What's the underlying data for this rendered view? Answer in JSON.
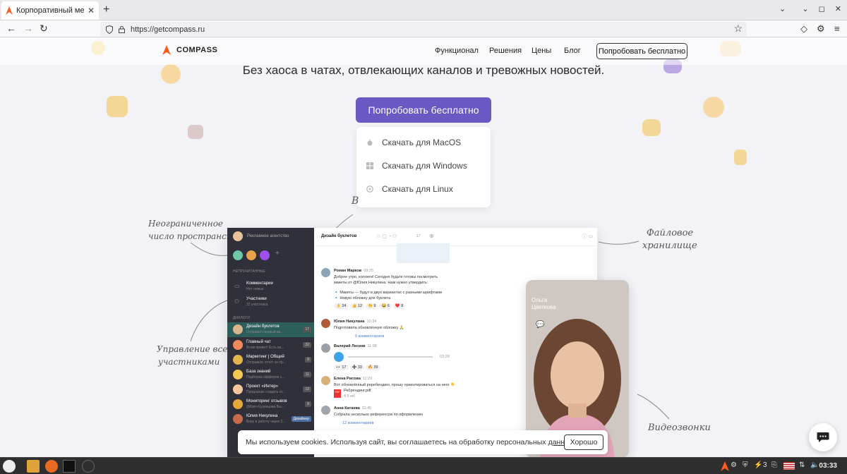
{
  "browser": {
    "tab_title": "Корпоративный мессендж",
    "url": "https://getcompass.ru"
  },
  "site": {
    "logo": "COMPASS",
    "nav": [
      "Функционал",
      "Решения",
      "Цены",
      "Блог"
    ],
    "try_top": "Попробовать бесплатно",
    "subheading": "Без хаоса в чатах, отвлекающих каналов и тревожных новостей.",
    "cta": "Попробовать бесплатно",
    "downloads": [
      "Скачать для MacOS",
      "Скачать для Windows",
      "Скачать для Linux"
    ],
    "annotation_partial": "В",
    "annotations": {
      "spaces_1": "Неограниченное",
      "spaces_2": "число пространств",
      "manage_1": "Управление всеми",
      "manage_2": "участниками",
      "files_1": "Файловое",
      "files_2": "хранилище",
      "video": "Видеозвонки"
    }
  },
  "app": {
    "workspace": "Рекламное агентство",
    "section_unread": "НЕПРОЧИТАННЫЕ",
    "section_dialogs": "ДИАЛОГИ",
    "pinned": [
      {
        "name": "Комментарии",
        "preview": "Нет новых"
      },
      {
        "name": "Участники",
        "preview": "32 участника"
      }
    ],
    "chats": [
      {
        "name": "Дизайн буклетов",
        "preview": "Отправил первый ва...",
        "badge": "17"
      },
      {
        "name": "Главный чат",
        "preview": "Всем привет! Есть ва...",
        "badge": "32"
      },
      {
        "name": "Маркетинг | Общий",
        "preview": "Отправьте отчёт за пр...",
        "badge": "8"
      },
      {
        "name": "База знаний",
        "preview": "Подборка офферов с...",
        "badge": "11"
      },
      {
        "name": "Проект «Интер»",
        "preview": "Предлагаю создать от...",
        "badge": "12"
      },
      {
        "name": "Мониторинг отзывов",
        "preview": "@Катя Кузнецова Вы...",
        "badge": "8"
      },
      {
        "name": "Юлия Никулина",
        "preview": "Беру в работу через 2...",
        "badge": "Дизайнер"
      }
    ],
    "chat_title": "Дизайн буклетов",
    "members": "17",
    "messages": [
      {
        "author": "Роман Марков",
        "time": "09:25",
        "lines": [
          "Доброе утро, коллеги! Сегодня будьте готовы посмотреть",
          "макеты от @Юлия Никулина. Нам нужно утвердить:",
          "🔹 Макеты — будут в двух вариантах с разными шрифтами",
          "🔹 Новую обложку для буклета"
        ],
        "reactions": [
          "👌 24",
          "👍 12",
          "👏 9",
          "😂 6",
          "❤️ 8"
        ]
      },
      {
        "author": "Юлия Никулина",
        "time": "10:34",
        "lines": [
          "Подготовила обновлённую обложку 🙏"
        ],
        "comments": "5 комментариев"
      },
      {
        "author": "Валерий Лесков",
        "time": "11:08",
        "lines": [],
        "audio": "03:28",
        "reactions": [
          "👀 17",
          "➕ 33",
          "🔥 39"
        ]
      },
      {
        "author": "Елена Рисова",
        "time": "11:29",
        "lines": [
          "Вот обновлённый реребендинг, прошу ориентироваться на него 👇"
        ],
        "file": "Ребрендинг.pdf",
        "size": "4.5 мб"
      },
      {
        "author": "Анна Катаева",
        "time": "11:45",
        "lines": [
          "Собрала несколько референсов по оформлению"
        ],
        "comments": "12 комментариев"
      }
    ],
    "call_name_1": "Ольга",
    "call_name_2": "Цветкова"
  },
  "cookie": {
    "text": "Мы используем cookies. Используя сайт, вы соглашаетесь на обработку персональных",
    "link": "данных",
    "period": ".",
    "button": "Хорошо"
  },
  "taskbar": {
    "workspace_num": "3",
    "time": "03:33"
  }
}
